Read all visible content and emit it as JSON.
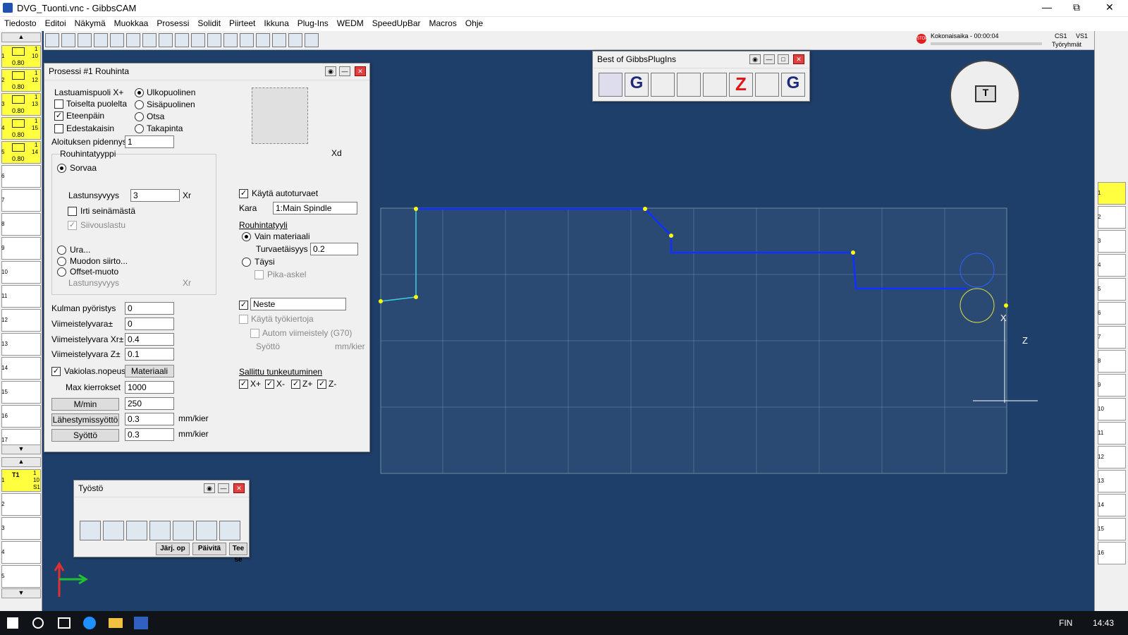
{
  "window": {
    "title": "DVG_Tuonti.vnc - GibbsCAM",
    "controls": [
      "—",
      "⧉",
      "✕"
    ]
  },
  "menu": [
    "Tiedosto",
    "Editoi",
    "Näkymä",
    "Muokkaa",
    "Prosessi",
    "Solidit",
    "Piirteet",
    "Ikkuna",
    "Plug-Ins",
    "WEDM",
    "SpeedUpBar",
    "Macros",
    "Ohje"
  ],
  "status": {
    "time": "Kokonaisaika - 00:00:04",
    "cs": "CS1",
    "vs": "VS1",
    "mode": "Työryhmät"
  },
  "tool_slots": [
    {
      "n": "1",
      "a": "1",
      "b": "10",
      "v": "0.80"
    },
    {
      "n": "2",
      "a": "1",
      "b": "12",
      "v": "0.80"
    },
    {
      "n": "3",
      "a": "1",
      "b": "13",
      "v": "0.80"
    },
    {
      "n": "4",
      "a": "1",
      "b": "15",
      "v": "0.80"
    },
    {
      "n": "5",
      "a": "1",
      "b": "14",
      "v": "0.80"
    }
  ],
  "empty_slots": [
    "6",
    "7",
    "8",
    "9",
    "10",
    "11",
    "12",
    "13",
    "14",
    "15",
    "16",
    "17"
  ],
  "process": {
    "title": "Prosessi #1 Rouhinta",
    "lastuamispuoli": "Lastuamispuoli X+",
    "toiselta": "Toiselta puolelta",
    "eteenpain": "Eteenpäin",
    "edestakaisin": "Edestakaisin",
    "ulkopuolinen": "Ulkopuolinen",
    "sisapuolinen": "Sisäpuolinen",
    "otsa": "Otsa",
    "takapinta": "Takapinta",
    "aloitus_label": "Aloituksen pidennys",
    "aloitus_value": "1",
    "rouhintatyyppi": "Rouhintatyyppi",
    "sorvaa": "Sorvaa",
    "lastunsyvyys": "Lastunsyvyys",
    "lastunsyvyys_value": "3",
    "xr": "Xr",
    "irti": "Irti seinämästä",
    "siivous": "Siivouslastu",
    "ura": "Ura...",
    "muodon": "Muodon siirto...",
    "offset": "Offset-muoto",
    "lastunsyvyys2": "Lastunsyvyys",
    "xr2": "Xr",
    "xd": "Xd",
    "kayta_auto": "Käytä autoturvaet",
    "kara_label": "Kara",
    "kara_value": "1:Main Spindle",
    "rouhintatyyli": "Rouhintatyyli",
    "vain": "Vain materiaali",
    "turva_label": "Turvaetäisyys",
    "turva_value": "0.2",
    "taysi": "Täysi",
    "pika": "Pika-askel",
    "kulman_label": "Kulman pyöristys",
    "kulman_value": "0",
    "viim_label": "Viimeistelyvara±",
    "viim_value": "0",
    "viimx_label": "Viimeistelyvara Xr±",
    "viimx_value": "0.4",
    "viimz_label": "Viimeistelyvara Z±",
    "viimz_value": "0.1",
    "vakio": "Vakiolas.nopeus",
    "materiaali": "Materiaali",
    "max_label": "Max kierrokset",
    "max_value": "1000",
    "mmin": "M/min",
    "mmin_value": "250",
    "lahes": "Lähestymissyöttö",
    "lahes_value": "0.3",
    "unit1": "mm/kier",
    "syotto": "Syöttö",
    "syotto_value": "0.3",
    "unit2": "mm/kier",
    "neste": "Neste",
    "kayta_tyo": "Käytä työkiertoja",
    "autom": "Autom viimeistely (G70)",
    "syotto2": "Syöttö",
    "unit3": "mm/kier",
    "sallittu": "Sallittu tunkeutuminen",
    "xplus": "X+",
    "xminus": "X-",
    "zplus": "Z+",
    "zminus": "Z-"
  },
  "plugins": {
    "title": "Best of GibbsPlugIns",
    "g": "G",
    "z": "Z"
  },
  "tyosto": {
    "title": "Työstö",
    "jarj": "Järj. op",
    "paivita": "Päivitä",
    "teese": "Tee se"
  },
  "wp": {
    "slot": "1",
    "t": "T1",
    "n": "1",
    "s": "10",
    "s1": "S1"
  },
  "right_slots": [
    "1",
    "2",
    "3",
    "4",
    "5",
    "6",
    "7",
    "8",
    "9",
    "10",
    "11",
    "12",
    "13",
    "14",
    "15",
    "16"
  ],
  "left_bottom_slots": [
    "1",
    "2",
    "3",
    "4",
    "5"
  ],
  "taskbar": {
    "lang": "FIN",
    "time": "14:43"
  },
  "axes": {
    "x": "X",
    "z": "Z"
  }
}
